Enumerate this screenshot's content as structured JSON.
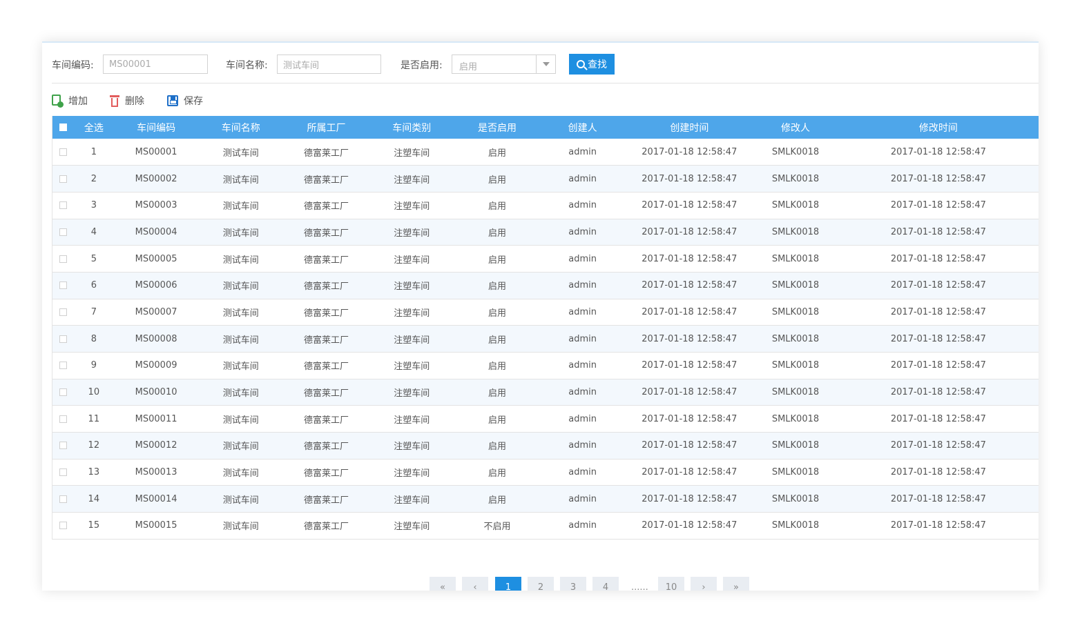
{
  "search": {
    "code_label": "车间编码:",
    "code_value": "MS00001",
    "name_label": "车间名称:",
    "name_value": "测试车间",
    "enabled_label": "是否启用:",
    "enabled_value": "启用",
    "search_button": "查找"
  },
  "toolbar": {
    "add_label": "增加",
    "delete_label": "删除",
    "save_label": "保存"
  },
  "table": {
    "headers": [
      "全选",
      "车间编码",
      "车间名称",
      "所属工厂",
      "车间类别",
      "是否启用",
      "创建人",
      "创建时间",
      "修改人",
      "修改时间"
    ],
    "rows": [
      {
        "no": "1",
        "code": "MS00001",
        "name": "测试车间",
        "factory": "德富莱工厂",
        "type": "注塑车间",
        "enabled": "启用",
        "creator": "admin",
        "created": "2017-01-18 12:58:47",
        "modifier": "SMLK0018",
        "modified": "2017-01-18 12:58:47"
      },
      {
        "no": "2",
        "code": "MS00002",
        "name": "测试车间",
        "factory": "德富莱工厂",
        "type": "注塑车间",
        "enabled": "启用",
        "creator": "admin",
        "created": "2017-01-18 12:58:47",
        "modifier": "SMLK0018",
        "modified": "2017-01-18 12:58:47"
      },
      {
        "no": "3",
        "code": "MS00003",
        "name": "测试车间",
        "factory": "德富莱工厂",
        "type": "注塑车间",
        "enabled": "启用",
        "creator": "admin",
        "created": "2017-01-18 12:58:47",
        "modifier": "SMLK0018",
        "modified": "2017-01-18 12:58:47"
      },
      {
        "no": "4",
        "code": "MS00004",
        "name": "测试车间",
        "factory": "德富莱工厂",
        "type": "注塑车间",
        "enabled": "启用",
        "creator": "admin",
        "created": "2017-01-18 12:58:47",
        "modifier": "SMLK0018",
        "modified": "2017-01-18 12:58:47"
      },
      {
        "no": "5",
        "code": "MS00005",
        "name": "测试车间",
        "factory": "德富莱工厂",
        "type": "注塑车间",
        "enabled": "启用",
        "creator": "admin",
        "created": "2017-01-18 12:58:47",
        "modifier": "SMLK0018",
        "modified": "2017-01-18 12:58:47"
      },
      {
        "no": "6",
        "code": "MS00006",
        "name": "测试车间",
        "factory": "德富莱工厂",
        "type": "注塑车间",
        "enabled": "启用",
        "creator": "admin",
        "created": "2017-01-18 12:58:47",
        "modifier": "SMLK0018",
        "modified": "2017-01-18 12:58:47"
      },
      {
        "no": "7",
        "code": "MS00007",
        "name": "测试车间",
        "factory": "德富莱工厂",
        "type": "注塑车间",
        "enabled": "启用",
        "creator": "admin",
        "created": "2017-01-18 12:58:47",
        "modifier": "SMLK0018",
        "modified": "2017-01-18 12:58:47"
      },
      {
        "no": "8",
        "code": "MS00008",
        "name": "测试车间",
        "factory": "德富莱工厂",
        "type": "注塑车间",
        "enabled": "启用",
        "creator": "admin",
        "created": "2017-01-18 12:58:47",
        "modifier": "SMLK0018",
        "modified": "2017-01-18 12:58:47"
      },
      {
        "no": "9",
        "code": "MS00009",
        "name": "测试车间",
        "factory": "德富莱工厂",
        "type": "注塑车间",
        "enabled": "启用",
        "creator": "admin",
        "created": "2017-01-18 12:58:47",
        "modifier": "SMLK0018",
        "modified": "2017-01-18 12:58:47"
      },
      {
        "no": "10",
        "code": "MS00010",
        "name": "测试车间",
        "factory": "德富莱工厂",
        "type": "注塑车间",
        "enabled": "启用",
        "creator": "admin",
        "created": "2017-01-18 12:58:47",
        "modifier": "SMLK0018",
        "modified": "2017-01-18 12:58:47"
      },
      {
        "no": "11",
        "code": "MS00011",
        "name": "测试车间",
        "factory": "德富莱工厂",
        "type": "注塑车间",
        "enabled": "启用",
        "creator": "admin",
        "created": "2017-01-18 12:58:47",
        "modifier": "SMLK0018",
        "modified": "2017-01-18 12:58:47"
      },
      {
        "no": "12",
        "code": "MS00012",
        "name": "测试车间",
        "factory": "德富莱工厂",
        "type": "注塑车间",
        "enabled": "启用",
        "creator": "admin",
        "created": "2017-01-18 12:58:47",
        "modifier": "SMLK0018",
        "modified": "2017-01-18 12:58:47"
      },
      {
        "no": "13",
        "code": "MS00013",
        "name": "测试车间",
        "factory": "德富莱工厂",
        "type": "注塑车间",
        "enabled": "启用",
        "creator": "admin",
        "created": "2017-01-18 12:58:47",
        "modifier": "SMLK0018",
        "modified": "2017-01-18 12:58:47"
      },
      {
        "no": "14",
        "code": "MS00014",
        "name": "测试车间",
        "factory": "德富莱工厂",
        "type": "注塑车间",
        "enabled": "启用",
        "creator": "admin",
        "created": "2017-01-18 12:58:47",
        "modifier": "SMLK0018",
        "modified": "2017-01-18 12:58:47"
      },
      {
        "no": "15",
        "code": "MS00015",
        "name": "测试车间",
        "factory": "德富莱工厂",
        "type": "注塑车间",
        "enabled": "不启用",
        "creator": "admin",
        "created": "2017-01-18 12:58:47",
        "modifier": "SMLK0018",
        "modified": "2017-01-18 12:58:47"
      }
    ]
  },
  "pagination": {
    "first": "«",
    "prev": "‹",
    "pages": [
      "1",
      "2",
      "3",
      "4"
    ],
    "ellipsis": "......",
    "last_page": "10",
    "next": "›",
    "last": "»",
    "current": "1"
  },
  "colors": {
    "accent": "#1e8fe1",
    "header_bg": "#4ea6ea"
  }
}
